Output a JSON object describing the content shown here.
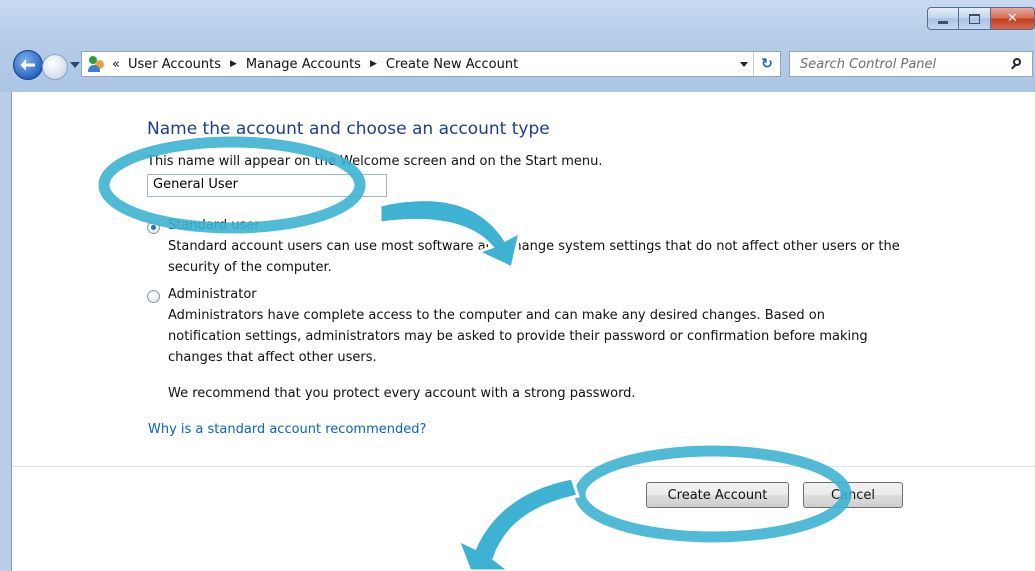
{
  "window": {
    "controls": {
      "minimize": "minimize",
      "maximize": "maximize",
      "close": "close"
    }
  },
  "nav": {
    "breadcrumb_prefix": "«",
    "breadcrumbs": [
      "User Accounts",
      "Manage Accounts",
      "Create New Account"
    ],
    "search_placeholder": "Search Control Panel"
  },
  "main": {
    "heading": "Name the account and choose an account type",
    "description": "This name will appear on the Welcome screen and on the Start menu.",
    "name_value": "General User",
    "options": [
      {
        "label": "Standard user",
        "selected": true,
        "description": "Standard account users can use most software and change system settings that do not affect other users or the security of the computer."
      },
      {
        "label": "Administrator",
        "selected": false,
        "description": "Administrators have complete access to the computer and can make any desired changes. Based on notification settings, administrators may be asked to provide their password or confirmation before making changes that affect other users."
      }
    ],
    "recommendation": "We recommend that you protect every account with a strong password.",
    "help_link": "Why is a standard account recommended?"
  },
  "footer": {
    "create_label": "Create Account",
    "cancel_label": "Cancel"
  },
  "colors": {
    "heading": "#1e3d91",
    "link": "#0a62c3",
    "annotation": "#3db2d3"
  }
}
